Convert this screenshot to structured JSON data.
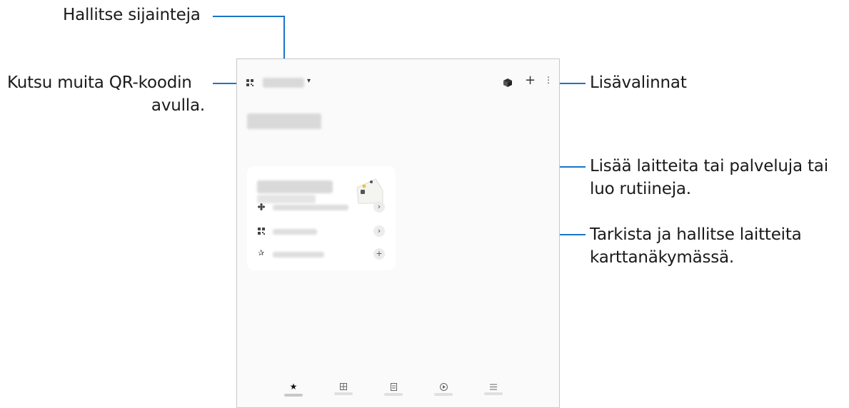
{
  "callouts": {
    "manage_locations": "Hallitse sijainteja",
    "invite_qr_line1": "Kutsu muita QR-koodin",
    "invite_qr_line2": "avulla.",
    "more_options": "Lisävalinnat",
    "add_devices_line1": "Lisää laitteita tai palveluja tai",
    "add_devices_line2": "luo rutiineja.",
    "map_view_line1": "Tarkista ja hallitse laitteita",
    "map_view_line2": "karttanäkymässä."
  },
  "colors": {
    "accent_line": "#1a73c8"
  },
  "icons": {
    "qr": "qr-code-icon",
    "dropdown": "caret-down-icon",
    "map": "map-view-icon",
    "add": "plus-icon",
    "more": "more-vertical-icon",
    "fan": "fan-icon",
    "star": "star-icon",
    "chevron": "chevron-right-icon"
  },
  "header_glyphs": {
    "add": "+",
    "more": "⋮",
    "dropdown": "▾"
  },
  "card_glyphs": {
    "chevron": "›",
    "plus": "+"
  },
  "bottom_nav": [
    "favorites",
    "devices",
    "life",
    "routines",
    "menu"
  ]
}
